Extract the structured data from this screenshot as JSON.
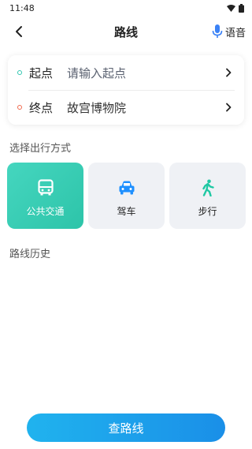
{
  "status_bar": {
    "time": "11:48"
  },
  "header": {
    "title": "路线",
    "voice_label": "语音"
  },
  "route": {
    "start": {
      "label": "起点",
      "placeholder": "请输入起点"
    },
    "end": {
      "label": "终点",
      "value": "故宫博物院"
    }
  },
  "modes": {
    "section_label": "选择出行方式",
    "items": [
      {
        "label": "公共交通",
        "icon": "bus-icon",
        "selected": true
      },
      {
        "label": "驾车",
        "icon": "car-icon",
        "selected": false
      },
      {
        "label": "步行",
        "icon": "walk-icon",
        "selected": false
      }
    ]
  },
  "history": {
    "section_label": "路线历史"
  },
  "action": {
    "search_label": "查路线"
  },
  "colors": {
    "accent_teal": "#2dc4a9",
    "accent_blue": "#1a8fe8",
    "start_dot": "#2fc6b0",
    "end_dot": "#f06a4e"
  }
}
